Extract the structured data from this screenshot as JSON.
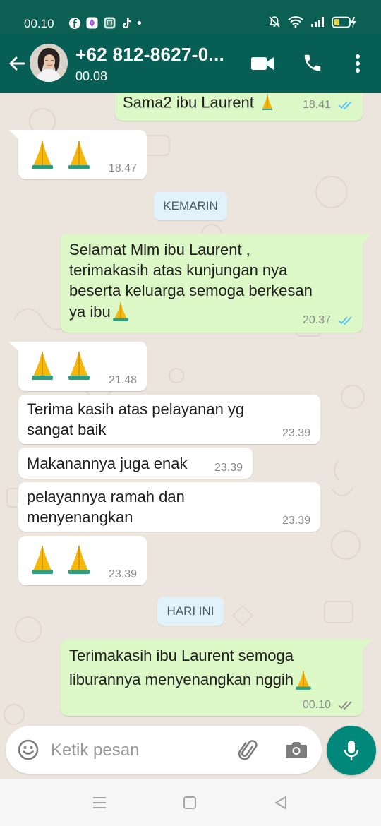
{
  "status_bar": {
    "time": "00.10",
    "icons": [
      "facebook-icon",
      "gallery-app-icon",
      "green-app-icon",
      "tiktok-icon",
      "dot-icon",
      "mute-icon",
      "wifi-icon",
      "signal-icon",
      "battery-icon"
    ],
    "battery_level": 0.35
  },
  "header": {
    "contact_name": "+62 812-8627-0...",
    "contact_status": "00.08",
    "icons": [
      "back-arrow-icon",
      "avatar",
      "video-call-icon",
      "phone-call-icon",
      "more-options-icon"
    ]
  },
  "messages": [
    {
      "direction": "out",
      "text": "Sama2 ibu Laurent 🙏",
      "time": "18.41",
      "ticks": "read"
    },
    {
      "direction": "in",
      "text": "🙏🙏",
      "time": "18.47"
    },
    {
      "type": "date",
      "label": "KEMARIN"
    },
    {
      "direction": "out",
      "text": "Selamat Mlm ibu Laurent , terimakasih atas kunjungan nya beserta keluarga semoga berkesan ya ibu🙏",
      "time": "20.37",
      "ticks": "read"
    },
    {
      "direction": "in",
      "text": "🙏🙏",
      "time": "21.48"
    },
    {
      "direction": "in",
      "text": "Terima kasih atas pelayanan yg sangat baik",
      "time": "23.39"
    },
    {
      "direction": "in",
      "text": "Makanannya juga enak",
      "time": "23.39"
    },
    {
      "direction": "in",
      "text": "pelayannya ramah dan menyenangkan",
      "time": "23.39"
    },
    {
      "direction": "in",
      "text": "🙏🙏",
      "time": "23.39"
    },
    {
      "type": "date",
      "label": "HARI INI"
    },
    {
      "direction": "out",
      "text": "Terimakasih ibu Laurent semoga liburannya menyenangkan nggih🙏",
      "time": "00.10",
      "ticks": "delivered"
    }
  ],
  "bubbles": {
    "m0": {
      "line1": "Sama2 ibu Laurent",
      "time": "18.41"
    },
    "m1": {
      "time": "18.47"
    },
    "d1": {
      "label": "KEMARIN"
    },
    "m2": {
      "line1": "Selamat Mlm ibu Laurent ,",
      "line2": "terimakasih atas kunjungan nya",
      "line3": "beserta keluarga semoga berkesan",
      "line4": "ya ibu",
      "time": "20.37"
    },
    "m3": {
      "time": "21.48"
    },
    "m4": {
      "line1": "Terima kasih atas pelayanan yg",
      "line2": "sangat baik",
      "time": "23.39"
    },
    "m5": {
      "line1": "Makanannya juga enak",
      "time": "23.39"
    },
    "m6": {
      "line1": "pelayannya ramah dan",
      "line2": "menyenangkan",
      "time": "23.39"
    },
    "m7": {
      "time": "23.39"
    },
    "d2": {
      "label": "HARI INI"
    },
    "m8": {
      "line1": "Terimakasih ibu Laurent semoga",
      "line2": "liburannya menyenangkan nggih",
      "time": "00.10"
    }
  },
  "composer": {
    "placeholder": "Ketik pesan",
    "icons": [
      "emoji-icon",
      "attach-icon",
      "camera-icon",
      "mic-icon"
    ]
  },
  "nav": {
    "icons": [
      "recents-icon",
      "home-icon",
      "back-icon"
    ]
  },
  "colors": {
    "header": "#075e54",
    "status_bar": "#0b5f53",
    "outgoing_bubble": "#dcf8c6",
    "incoming_bubble": "#ffffff",
    "chat_background": "#ece5dd",
    "read_ticks": "#4fc3f7",
    "accent": "#00897b"
  }
}
